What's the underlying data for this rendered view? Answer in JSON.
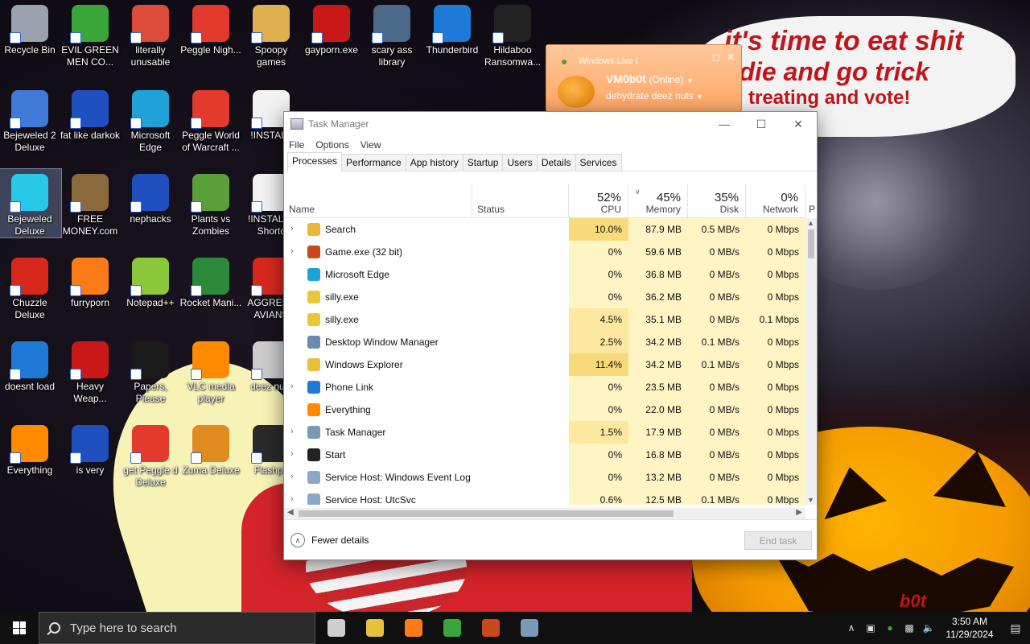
{
  "wallpaper": {
    "bubble_line1": "it's time to eat shit",
    "bubble_line2": "d die and go trick",
    "bubble_line3": "treating and vote!",
    "corner_tag": "b0t"
  },
  "desktop_icons": [
    {
      "label": "Recycle Bin",
      "icon": "recycle-bin-icon",
      "color": "#9aa3ad"
    },
    {
      "label": "EVIL GREEN MEN CO...",
      "icon": "messenger-people-icon",
      "color": "#3aa53a"
    },
    {
      "label": "literally unusable",
      "icon": "chrome-icon",
      "color": "#dd4b39"
    },
    {
      "label": "Peggle Nigh...",
      "icon": "peggle-icon",
      "color": "#e23b2e"
    },
    {
      "label": "Spoopy games",
      "icon": "folder-icon",
      "color": "#e0b050"
    },
    {
      "label": "gayporn.exe",
      "icon": "flash-icon",
      "color": "#c81818"
    },
    {
      "label": "scary ass library",
      "icon": "library-icon",
      "color": "#4b6a8a"
    },
    {
      "label": "Thunderbird",
      "icon": "thunderbird-icon",
      "color": "#1e7ad6"
    },
    {
      "label": "Hildaboo Ransomwa...",
      "icon": "yashma-icon",
      "color": "#222222"
    },
    {
      "label": "Bejeweled 2 Deluxe",
      "icon": "bejeweled2-icon",
      "color": "#3f7ad6"
    },
    {
      "label": "fat like darkok",
      "icon": "mpi-icon",
      "color": "#2050c0"
    },
    {
      "label": "Microsoft Edge",
      "icon": "edge-icon",
      "color": "#1fa2d6"
    },
    {
      "label": "Peggle World of Warcraft ...",
      "icon": "peggle-icon",
      "color": "#e23b2e"
    },
    {
      "label": "!INSTALL",
      "icon": "document-icon",
      "color": "#f2f2f2"
    },
    {
      "label": "Bejeweled Deluxe",
      "icon": "diamond-icon",
      "color": "#28c8e8"
    },
    {
      "label": "FREE MONEY.com",
      "icon": "money-bag-icon",
      "color": "#8a6a3a"
    },
    {
      "label": "nephacks",
      "icon": "mpi-icon",
      "color": "#2050c0"
    },
    {
      "label": "Plants vs Zombies",
      "icon": "plant-icon",
      "color": "#5aa03a"
    },
    {
      "label": "!INSTALL - Shortc",
      "icon": "document-icon",
      "color": "#f2f2f2"
    },
    {
      "label": "Chuzzle Deluxe",
      "icon": "chuzzle-icon",
      "color": "#d8281e"
    },
    {
      "label": "furryporn",
      "icon": "firefox-icon",
      "color": "#ff7a18"
    },
    {
      "label": "Notepad++",
      "icon": "notepad-icon",
      "color": "#8ac83a"
    },
    {
      "label": "Rocket Mani...",
      "icon": "rocket-icon",
      "color": "#2a8a3a"
    },
    {
      "label": "AGGRESS AVIANS",
      "icon": "angry-bird-icon",
      "color": "#d8281e"
    },
    {
      "label": "doesnt load",
      "icon": "thunderbird-icon",
      "color": "#1e7ad6"
    },
    {
      "label": "Heavy Weap...",
      "icon": "radiation-icon",
      "color": "#c81818"
    },
    {
      "label": "Papers, Please",
      "icon": "papers-please-icon",
      "color": "#1a1a1a"
    },
    {
      "label": "VLC media player",
      "icon": "vlc-cone-icon",
      "color": "#ff8a00"
    },
    {
      "label": "deez nuts",
      "icon": "windows-stack-icon",
      "color": "#cccccc"
    },
    {
      "label": "Everything",
      "icon": "magnifier-icon",
      "color": "#ff8a00"
    },
    {
      "label": "is very",
      "icon": "mpi-shield-icon",
      "color": "#2050c0"
    },
    {
      "label": "get Peggle d Deluxe",
      "icon": "peggle-icon",
      "color": "#e23b2e"
    },
    {
      "label": "Zuma Deluxe",
      "icon": "zuma-icon",
      "color": "#e08a20"
    },
    {
      "label": "Flashpo",
      "icon": "flashpoint-icon",
      "color": "#2a2a2a"
    }
  ],
  "messenger_popup": {
    "title": "Windows Live I",
    "username": "VM0b0t",
    "status": "(Online)",
    "message": "dehydrate deez nuts"
  },
  "task_manager": {
    "title": "Task Manager",
    "menu": [
      "File",
      "Options",
      "View"
    ],
    "tabs": [
      "Processes",
      "Performance",
      "App history",
      "Startup",
      "Users",
      "Details",
      "Services"
    ],
    "active_tab": "Processes",
    "columns": {
      "name": "Name",
      "status": "Status",
      "cpu_pct": "52%",
      "cpu": "CPU",
      "mem_pct": "45%",
      "mem": "Memory",
      "disk_pct": "35%",
      "disk": "Disk",
      "net_pct": "0%",
      "net": "Network",
      "extra": "P"
    },
    "processes": [
      {
        "name": "Search",
        "expandable": true,
        "icon": "search-icon",
        "icolor": "#e8b838",
        "cpu": "10.0%",
        "mem": "87.9 MB",
        "disk": "0.5 MB/s",
        "net": "0 Mbps"
      },
      {
        "name": "Game.exe (32 bit)",
        "expandable": true,
        "icon": "game-icon",
        "icolor": "#c84a1a",
        "cpu": "0%",
        "mem": "59.6 MB",
        "disk": "0 MB/s",
        "net": "0 Mbps"
      },
      {
        "name": "Microsoft Edge",
        "expandable": false,
        "icon": "edge-icon",
        "icolor": "#1fa2d6",
        "cpu": "0%",
        "mem": "36.8 MB",
        "disk": "0 MB/s",
        "net": "0 Mbps"
      },
      {
        "name": "silly.exe",
        "expandable": false,
        "icon": "exe-icon",
        "icolor": "#e8c838",
        "cpu": "0%",
        "mem": "36.2 MB",
        "disk": "0 MB/s",
        "net": "0 Mbps"
      },
      {
        "name": "silly.exe",
        "expandable": false,
        "icon": "exe-icon",
        "icolor": "#e8c838",
        "cpu": "4.5%",
        "mem": "35.1 MB",
        "disk": "0 MB/s",
        "net": "0.1 Mbps"
      },
      {
        "name": "Desktop Window Manager",
        "expandable": false,
        "icon": "dwm-icon",
        "icolor": "#6a8ab0",
        "cpu": "2.5%",
        "mem": "34.2 MB",
        "disk": "0.1 MB/s",
        "net": "0 Mbps"
      },
      {
        "name": "Windows Explorer",
        "expandable": false,
        "icon": "folder-icon",
        "icolor": "#e8c040",
        "cpu": "11.4%",
        "mem": "34.2 MB",
        "disk": "0.1 MB/s",
        "net": "0 Mbps"
      },
      {
        "name": "Phone Link",
        "expandable": true,
        "icon": "phone-link-icon",
        "icolor": "#1e7ad6",
        "cpu": "0%",
        "mem": "23.5 MB",
        "disk": "0 MB/s",
        "net": "0 Mbps"
      },
      {
        "name": "Everything",
        "expandable": false,
        "icon": "magnifier-icon",
        "icolor": "#ff8a00",
        "cpu": "0%",
        "mem": "22.0 MB",
        "disk": "0 MB/s",
        "net": "0 Mbps"
      },
      {
        "name": "Task Manager",
        "expandable": true,
        "icon": "task-manager-icon",
        "icolor": "#7a9ab8",
        "cpu": "1.5%",
        "mem": "17.9 MB",
        "disk": "0 MB/s",
        "net": "0 Mbps"
      },
      {
        "name": "Start",
        "expandable": true,
        "icon": "start-icon",
        "icolor": "#222222",
        "cpu": "0%",
        "mem": "16.8 MB",
        "disk": "0 MB/s",
        "net": "0 Mbps"
      },
      {
        "name": "Service Host: Windows Event Log",
        "expandable": true,
        "icon": "gear-icon",
        "icolor": "#8aa8c8",
        "cpu": "0%",
        "mem": "13.2 MB",
        "disk": "0 MB/s",
        "net": "0 Mbps"
      },
      {
        "name": "Service Host: UtcSvc",
        "expandable": true,
        "icon": "gear-icon",
        "icolor": "#8aa8c8",
        "cpu": "0.6%",
        "mem": "12.5 MB",
        "disk": "0.1 MB/s",
        "net": "0 Mbps"
      }
    ],
    "fewer_details": "Fewer details",
    "end_task": "End task",
    "colors": {
      "heat_low": "#fff4c4",
      "heat_mid": "#fde8a0",
      "heat_high": "#f9da7a"
    }
  },
  "taskbar": {
    "search_placeholder": "Type here to search",
    "time": "3:50 AM",
    "date": "11/29/2024",
    "pinned": [
      {
        "icon": "task-view-icon",
        "color": "#cfcfcf"
      },
      {
        "icon": "file-explorer-icon",
        "color": "#e8c040"
      },
      {
        "icon": "firefox-icon",
        "color": "#ff7a18"
      },
      {
        "icon": "messenger-people-icon",
        "color": "#3aa53a"
      },
      {
        "icon": "game-icon",
        "color": "#c84a1a"
      },
      {
        "icon": "task-manager-icon",
        "color": "#7a9ab8"
      }
    ]
  }
}
